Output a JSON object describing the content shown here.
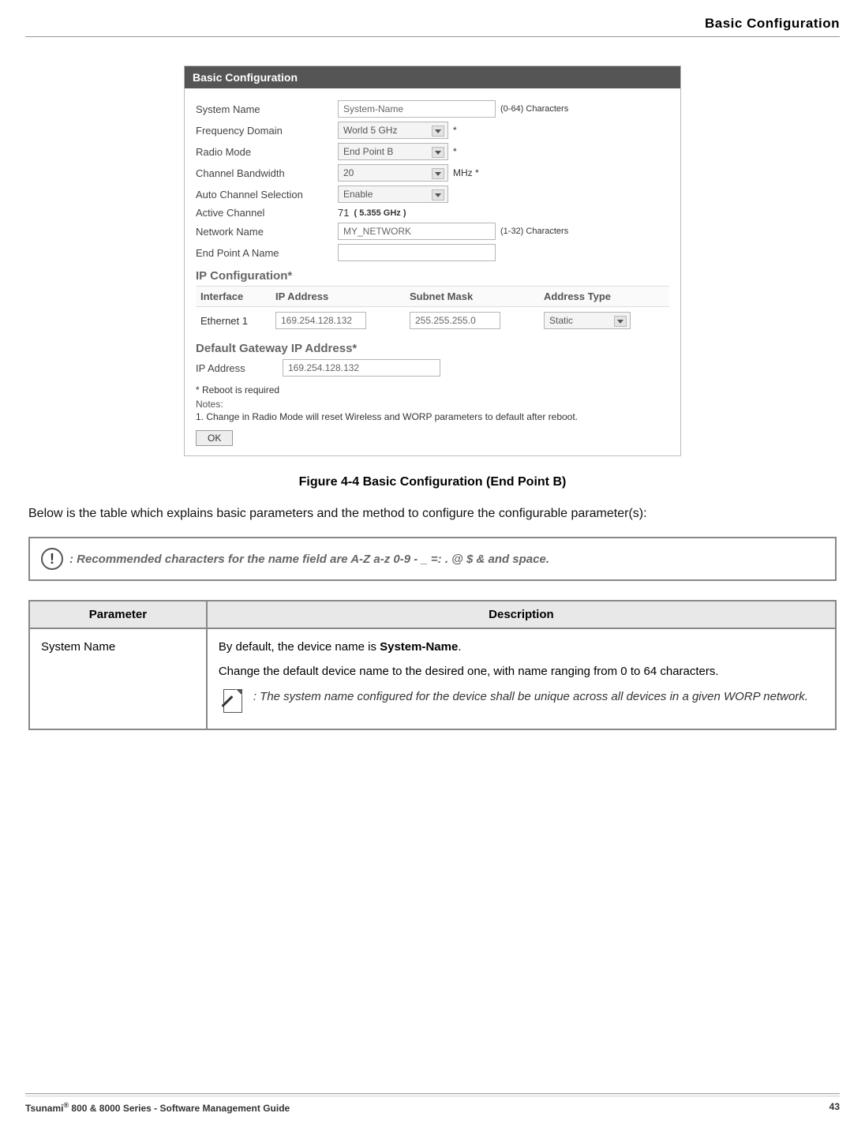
{
  "header": {
    "title": "Basic Configuration"
  },
  "screenshot": {
    "panel_title": "Basic Configuration",
    "fields": {
      "system_name": {
        "label": "System Name",
        "value": "System-Name",
        "hint": "(0-64) Characters"
      },
      "freq_domain": {
        "label": "Frequency Domain",
        "value": "World 5 GHz",
        "suffix": "*"
      },
      "radio_mode": {
        "label": "Radio Mode",
        "value": "End Point B",
        "suffix": "*"
      },
      "ch_bw": {
        "label": "Channel Bandwidth",
        "value": "20",
        "suffix": "MHz *"
      },
      "auto_ch": {
        "label": "Auto Channel Selection",
        "value": "Enable"
      },
      "active_ch": {
        "label": "Active Channel",
        "value": "71",
        "suffix": "( 5.355 GHz )"
      },
      "net_name": {
        "label": "Network Name",
        "value": "MY_NETWORK",
        "hint": "(1-32) Characters"
      },
      "epa_name": {
        "label": "End Point A Name",
        "value": ""
      }
    },
    "ip_section": {
      "title": "IP Configuration*",
      "cols": {
        "if": "Interface",
        "ip": "IP Address",
        "sm": "Subnet Mask",
        "at": "Address Type"
      },
      "row": {
        "if": "Ethernet 1",
        "ip": "169.254.128.132",
        "sm": "255.255.255.0",
        "at": "Static"
      }
    },
    "gw_section": {
      "title": "Default Gateway IP Address*",
      "label": "IP Address",
      "value": "169.254.128.132"
    },
    "reboot_note": "* Reboot is required",
    "notes_label": "Notes:",
    "notes_text": "1.  Change in Radio Mode will reset Wireless and WORP parameters to default after reboot.",
    "ok": "OK"
  },
  "figure_caption": "Figure 4-4 Basic Configuration (End Point B)",
  "intro_text": "Below is the table which explains basic parameters and the method to configure the configurable parameter(s):",
  "callout_text": ": Recommended characters for the name field are A-Z a-z 0-9 - _ =: . @ $ & and space.",
  "table": {
    "col1": "Parameter",
    "col2": "Description",
    "rows": [
      {
        "param": "System Name",
        "desc_line1_pre": "By default, the device name is ",
        "desc_line1_bold": "System-Name",
        "desc_line1_post": ".",
        "desc_line2": "Change the default device name to the desired one, with name ranging from 0 to 64 characters.",
        "note": ": The system name configured for the device shall be unique across all devices in a given WORP network."
      }
    ]
  },
  "footer": {
    "left_pre": "Tsunami",
    "left_post": " 800 & 8000 Series - Software Management Guide",
    "page": "43"
  }
}
